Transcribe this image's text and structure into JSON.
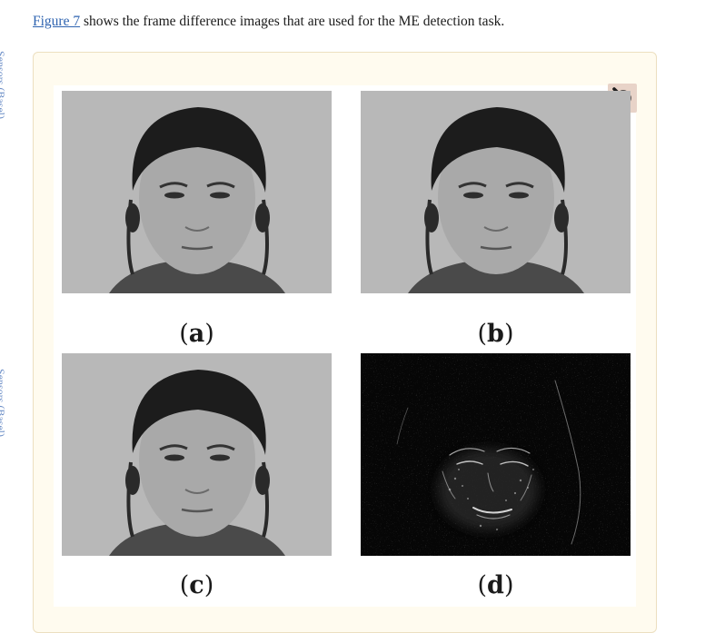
{
  "intro": {
    "link_text": "Figure 7",
    "rest": " shows the frame difference images that are used for the ME detection task."
  },
  "side_links": [
    "Sensors (Basel)",
    "Sensors (Basel)"
  ],
  "figure": {
    "zoom_icon": "magnifier-icon",
    "panels": [
      {
        "label": "a",
        "kind": "grayscale-face-photo"
      },
      {
        "label": "b",
        "kind": "grayscale-face-photo"
      },
      {
        "label": "c",
        "kind": "grayscale-face-photo"
      },
      {
        "label": "d",
        "kind": "frame-difference-image"
      }
    ]
  },
  "colors": {
    "link": "#2e63b0",
    "figure_background": "#fffbef",
    "zoom_button": "#e8d3c8"
  }
}
